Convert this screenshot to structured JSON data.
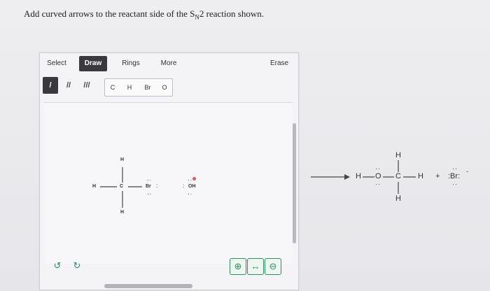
{
  "question": {
    "prefix": "Add curved arrows to the reactant side of the S",
    "sub": "N",
    "suffix": "2 reaction shown."
  },
  "toolbar": {
    "tabs": [
      "Select",
      "Draw",
      "Rings",
      "More"
    ],
    "erase_label": "Erase"
  },
  "bond_tools": [
    "/",
    "//",
    "///"
  ],
  "atom_tools": [
    "C",
    "H",
    "Br",
    "O"
  ],
  "reactant1": {
    "center": "C",
    "top": "H",
    "left": "H",
    "bottom": "H",
    "right": "Br"
  },
  "reactant2": {
    "label": "OH"
  },
  "product": {
    "h_left": "H",
    "o": "O",
    "c": "C",
    "h_right": "H",
    "h_top": "H",
    "h_bottom": "H",
    "plus": "+",
    "br": ":Br:"
  },
  "icons": {
    "undo": "undo-icon",
    "redo": "redo-icon",
    "zoom_in": "zoom-in-icon",
    "reset": "reset-view-icon",
    "zoom_out": "zoom-out-icon"
  },
  "colors": {
    "active_tab": "#3a3a3e",
    "zoom_green": "#2f8f5f",
    "lone_pair_red": "#e05a5a"
  }
}
